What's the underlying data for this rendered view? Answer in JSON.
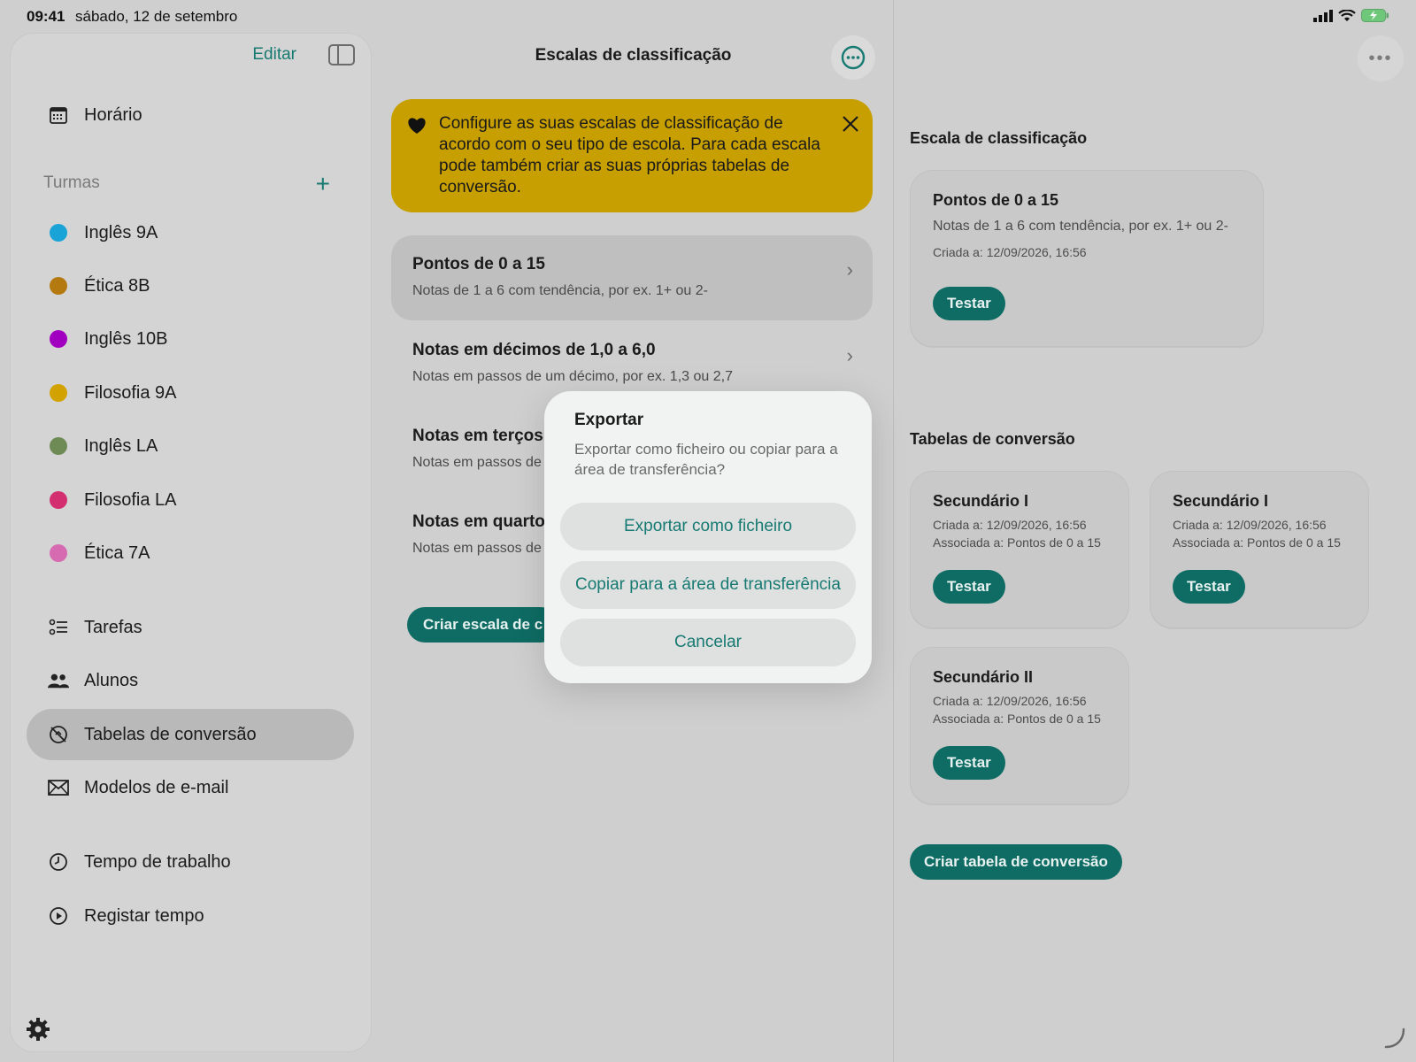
{
  "status": {
    "time": "09:41",
    "date": "sábado, 12 de setembro"
  },
  "sidebar": {
    "edit_label": "Editar",
    "schedule_label": "Horário",
    "classes_title": "Turmas",
    "classes": [
      {
        "label": "Inglês 9A",
        "color": "#1aa3d6"
      },
      {
        "label": "Ética 8B",
        "color": "#b47a10"
      },
      {
        "label": "Inglês 10B",
        "color": "#a100c0"
      },
      {
        "label": "Filosofia 9A",
        "color": "#d2a300"
      },
      {
        "label": "Inglês LA",
        "color": "#6e8a55"
      },
      {
        "label": "Filosofia LA",
        "color": "#d22e70"
      },
      {
        "label": "Ética 7A",
        "color": "#d66bb2"
      }
    ],
    "tasks_label": "Tarefas",
    "students_label": "Alunos",
    "conversion_label": "Tabelas de conversão",
    "email_label": "Modelos de e-mail",
    "worktime_label": "Tempo de trabalho",
    "register_label": "Registar tempo"
  },
  "middle": {
    "title": "Escalas de classificação",
    "banner": "Configure as suas escalas de classificação de acordo com o seu tipo de escola. Para cada escala pode também criar as suas próprias tabelas de conversão.",
    "scales": [
      {
        "title": "Pontos de 0 a 15",
        "subtitle": "Notas de 1 a 6 com tendência, por ex. 1+ ou 2-"
      },
      {
        "title": "Notas em décimos de 1,0 a 6,0",
        "subtitle": "Notas em passos de um décimo, por ex. 1,3 ou 2,7"
      },
      {
        "title": "Notas em terços",
        "subtitle": "Notas em passos de"
      },
      {
        "title": "Notas em quarto",
        "subtitle": "Notas em passos de"
      }
    ],
    "create_label": "Criar escala de c"
  },
  "right": {
    "scale_section": "Escala de classificação",
    "scale_card": {
      "title": "Pontos de 0 a 15",
      "subtitle": "Notas de 1 a 6 com tendência, por ex. 1+ ou 2-",
      "created": "Criada a: 12/09/2026, 16:56",
      "test_label": "Testar"
    },
    "tables_section": "Tabelas de conversão",
    "tables": [
      {
        "title": "Secundário I",
        "created": "Criada a: 12/09/2026, 16:56",
        "assoc": "Associada a: Pontos de 0 a 15",
        "test_label": "Testar"
      },
      {
        "title": "Secundário I",
        "created": "Criada a: 12/09/2026, 16:56",
        "assoc": "Associada a: Pontos de 0 a 15",
        "test_label": "Testar"
      },
      {
        "title": "Secundário II",
        "created": "Criada a: 12/09/2026, 16:56",
        "assoc": "Associada a: Pontos de 0 a 15",
        "test_label": "Testar"
      }
    ],
    "create_table_label": "Criar tabela de conversão"
  },
  "dialog": {
    "title": "Exportar",
    "message": "Exportar como ficheiro ou copiar para a área de transferência?",
    "export_file": "Exportar como ficheiro",
    "copy_clipboard": "Copiar para a área de transferência",
    "cancel": "Cancelar"
  },
  "colors": {
    "accent": "#177a72",
    "button": "#0e6c64",
    "banner": "#c89f00"
  }
}
